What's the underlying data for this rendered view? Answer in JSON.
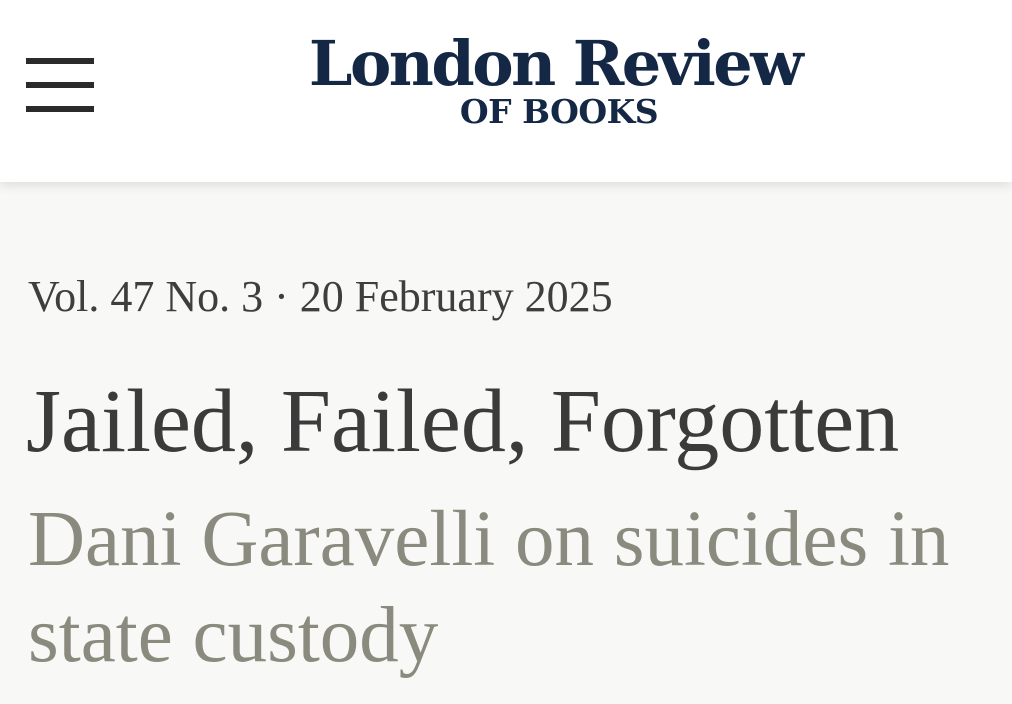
{
  "header": {
    "menu_icon": "hamburger-menu-icon",
    "logo_line1": "London Review",
    "logo_line2": "OF BOOKS",
    "logo_color": "#142744"
  },
  "article": {
    "issue": "Vol. 47 No. 3 · 20 February 2025",
    "title": "Jailed, Failed, Forgotten",
    "standfirst": "Dani Garavelli on suicides in state custody",
    "standfirst_color": "#8a8a7e"
  }
}
